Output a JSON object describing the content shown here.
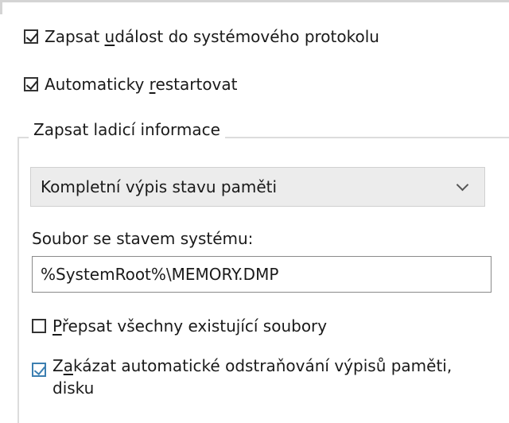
{
  "options": {
    "write_event": {
      "label_pre": "Zapsat ",
      "label_u": "u",
      "label_post": "dálost do systémového protokolu",
      "checked": true
    },
    "auto_restart": {
      "label_pre": "Automaticky ",
      "label_u": "r",
      "label_post": "estartovat",
      "checked": true
    }
  },
  "debug_group": {
    "title": "Zapsat ladicí informace",
    "dump_type": {
      "selected": "Kompletní výpis stavu paměti"
    },
    "dump_file": {
      "label": "Soubor se stavem systému:",
      "value": "%SystemRoot%\\MEMORY.DMP"
    },
    "overwrite": {
      "label_pre": "",
      "label_u": "P",
      "label_post": "řepsat všechny existující soubory",
      "checked": false
    },
    "disable_auto_delete": {
      "label_line1_pre": "Z",
      "label_line1_u": "a",
      "label_line1_post": "kázat automatické odstraňování výpisů paměti,",
      "label_line2": "disku",
      "checked": true
    }
  },
  "icons": {
    "checkbox_checked": "check-icon",
    "dropdown": "chevron-down-icon"
  },
  "colors": {
    "focus_checkbox": "#3c7fb1",
    "select_bg": "#ececec"
  }
}
